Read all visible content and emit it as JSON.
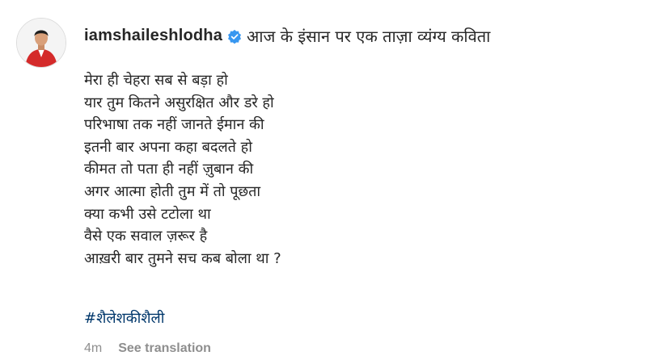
{
  "post": {
    "username": "iamshaileshlodha",
    "verified_icon": "verified-badge-icon",
    "caption_title": "आज के इंसान पर एक ताज़ा व्यंग्य कविता",
    "poem_lines": [
      "मेरा ही चेहरा सब से बड़ा हो",
      "यार तुम कितने असुरक्षित और डरे हो",
      "परिभाषा तक नहीं जानते ईमान की",
      "इतनी बार अपना कहा बदलते हो",
      "कीमत तो पता ही नहीं ज़ुबान की",
      "अगर आत्मा होती तुम में तो पूछता",
      "क्या कभी उसे टटोला था",
      "वैसे एक सवाल ज़रूर है",
      "आख़री बार तुमने सच कब बोला था ?"
    ],
    "hashtag": "#शैलेशकीशैली",
    "timestamp": "4m",
    "translate_label": "See translation"
  },
  "colors": {
    "text": "#262626",
    "muted": "#8e8e8e",
    "link": "#00376b",
    "verified": "#3897f0",
    "avatar_shirt": "#d42a2a"
  }
}
